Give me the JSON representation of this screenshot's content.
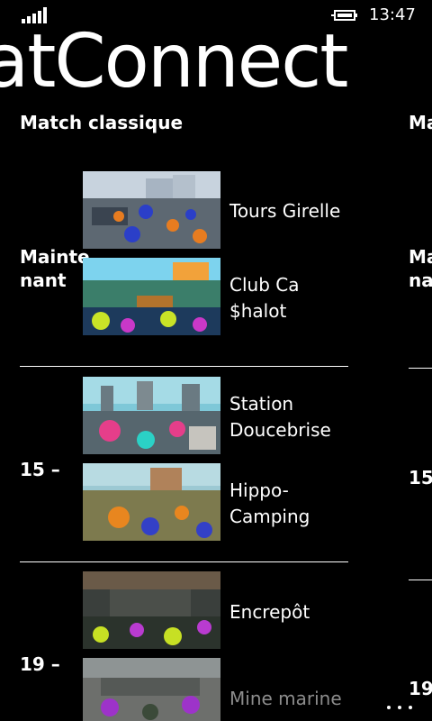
{
  "status": {
    "time": "13:47"
  },
  "app": {
    "title": "atConnect"
  },
  "pivot": {
    "current_header": "Match classique",
    "next_header": "Ma"
  },
  "schedule": [
    {
      "time_label": "Mainte\nnant",
      "maps": [
        {
          "name": "Tours Girelle"
        },
        {
          "name": "Club Ca\n$halot"
        }
      ]
    },
    {
      "time_label": "15 –",
      "maps": [
        {
          "name": "Station\nDoucebrise"
        },
        {
          "name": "Hippo-\nCamping"
        }
      ]
    },
    {
      "time_label": "19 –",
      "maps": [
        {
          "name": "Encrepôt"
        },
        {
          "name": "Mine marine"
        }
      ]
    }
  ],
  "next_pivot_labels": [
    "Ma\nnan",
    "15",
    "19"
  ],
  "icons": {
    "signal": "signal-strength-icon",
    "battery": "battery-charging-icon",
    "more": "more-dots-icon"
  }
}
